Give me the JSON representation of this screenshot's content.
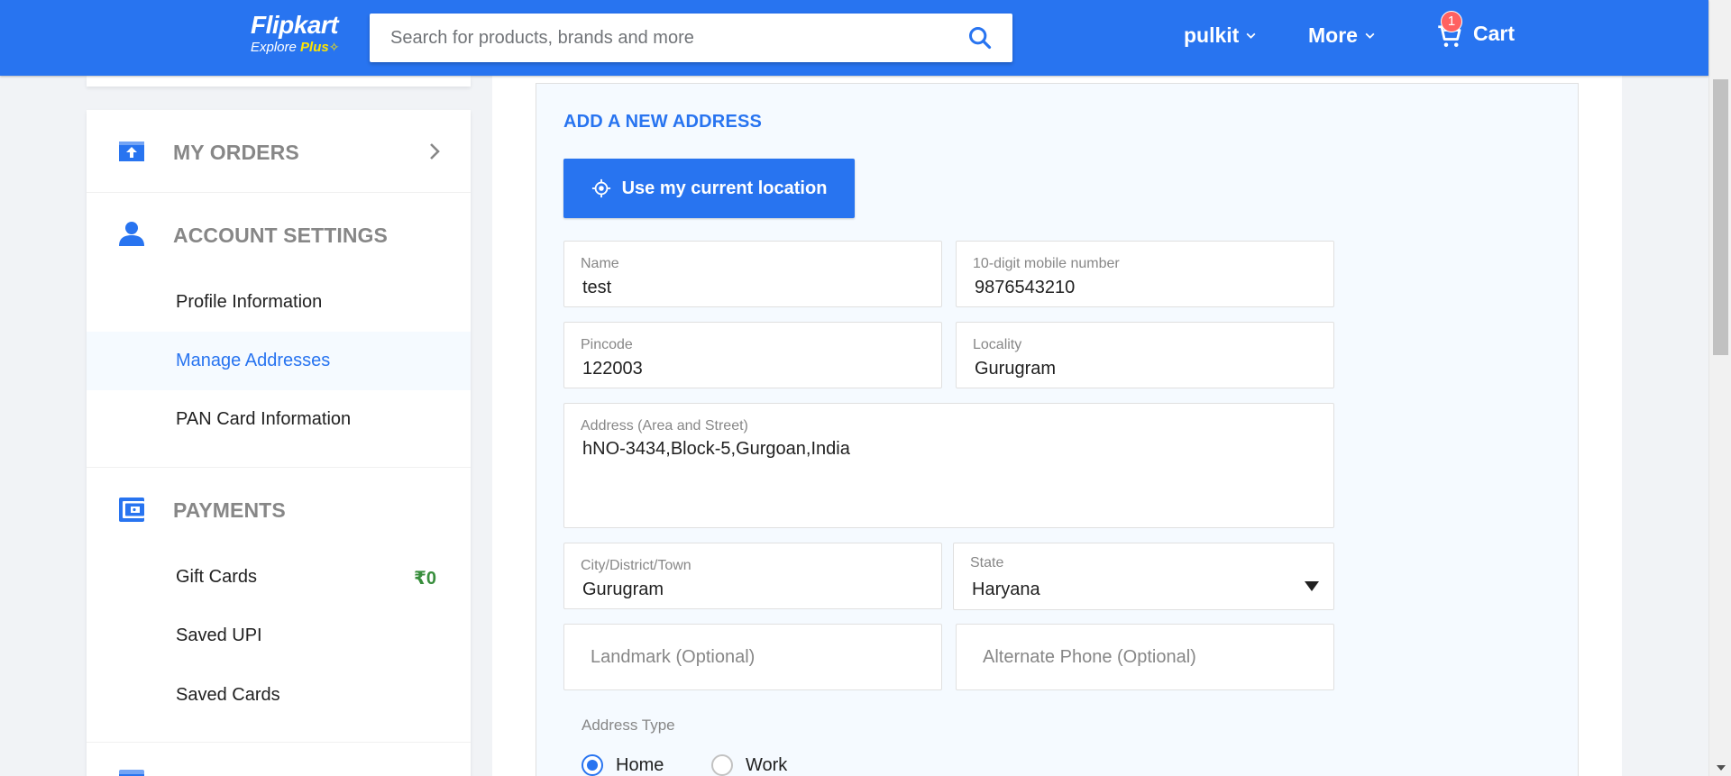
{
  "header": {
    "logo_main": "Flipkart",
    "logo_sub_prefix": "Explore ",
    "logo_sub_plus": "Plus",
    "search_placeholder": "Search for products, brands and more",
    "user_label": "pulkit",
    "more_label": "More",
    "cart_label": "Cart",
    "cart_count": "1",
    "brand_color": "#2874f0"
  },
  "sidebar": {
    "my_orders": {
      "title": "MY ORDERS",
      "icon": "orders-icon"
    },
    "account_settings": {
      "title": "ACCOUNT SETTINGS",
      "icon": "user-icon",
      "items": [
        {
          "label": "Profile Information"
        },
        {
          "label": "Manage Addresses",
          "active": true
        },
        {
          "label": "PAN Card Information"
        }
      ]
    },
    "payments": {
      "title": "PAYMENTS",
      "icon": "wallet-icon",
      "items": [
        {
          "label": "Gift Cards",
          "amount": "₹0"
        },
        {
          "label": "Saved UPI"
        },
        {
          "label": "Saved Cards"
        }
      ]
    }
  },
  "form": {
    "title": "ADD A NEW ADDRESS",
    "location_button": "Use my current location",
    "name": {
      "label": "Name",
      "value": "test"
    },
    "mobile": {
      "label": "10-digit mobile number",
      "value": "9876543210"
    },
    "pincode": {
      "label": "Pincode",
      "value": "122003"
    },
    "locality": {
      "label": "Locality",
      "value": "Gurugram"
    },
    "address": {
      "label": "Address (Area and Street)",
      "value": "hNO-3434,Block-5,Gurgoan,India"
    },
    "city": {
      "label": "City/District/Town",
      "value": "Gurugram"
    },
    "state": {
      "label": "State",
      "value": "Haryana"
    },
    "landmark": {
      "placeholder": "Landmark (Optional)"
    },
    "alt_phone": {
      "placeholder": "Alternate Phone (Optional)"
    },
    "address_type": {
      "label": "Address Type",
      "options": [
        {
          "label": "Home",
          "checked": true
        },
        {
          "label": "Work",
          "checked": false
        }
      ]
    }
  }
}
